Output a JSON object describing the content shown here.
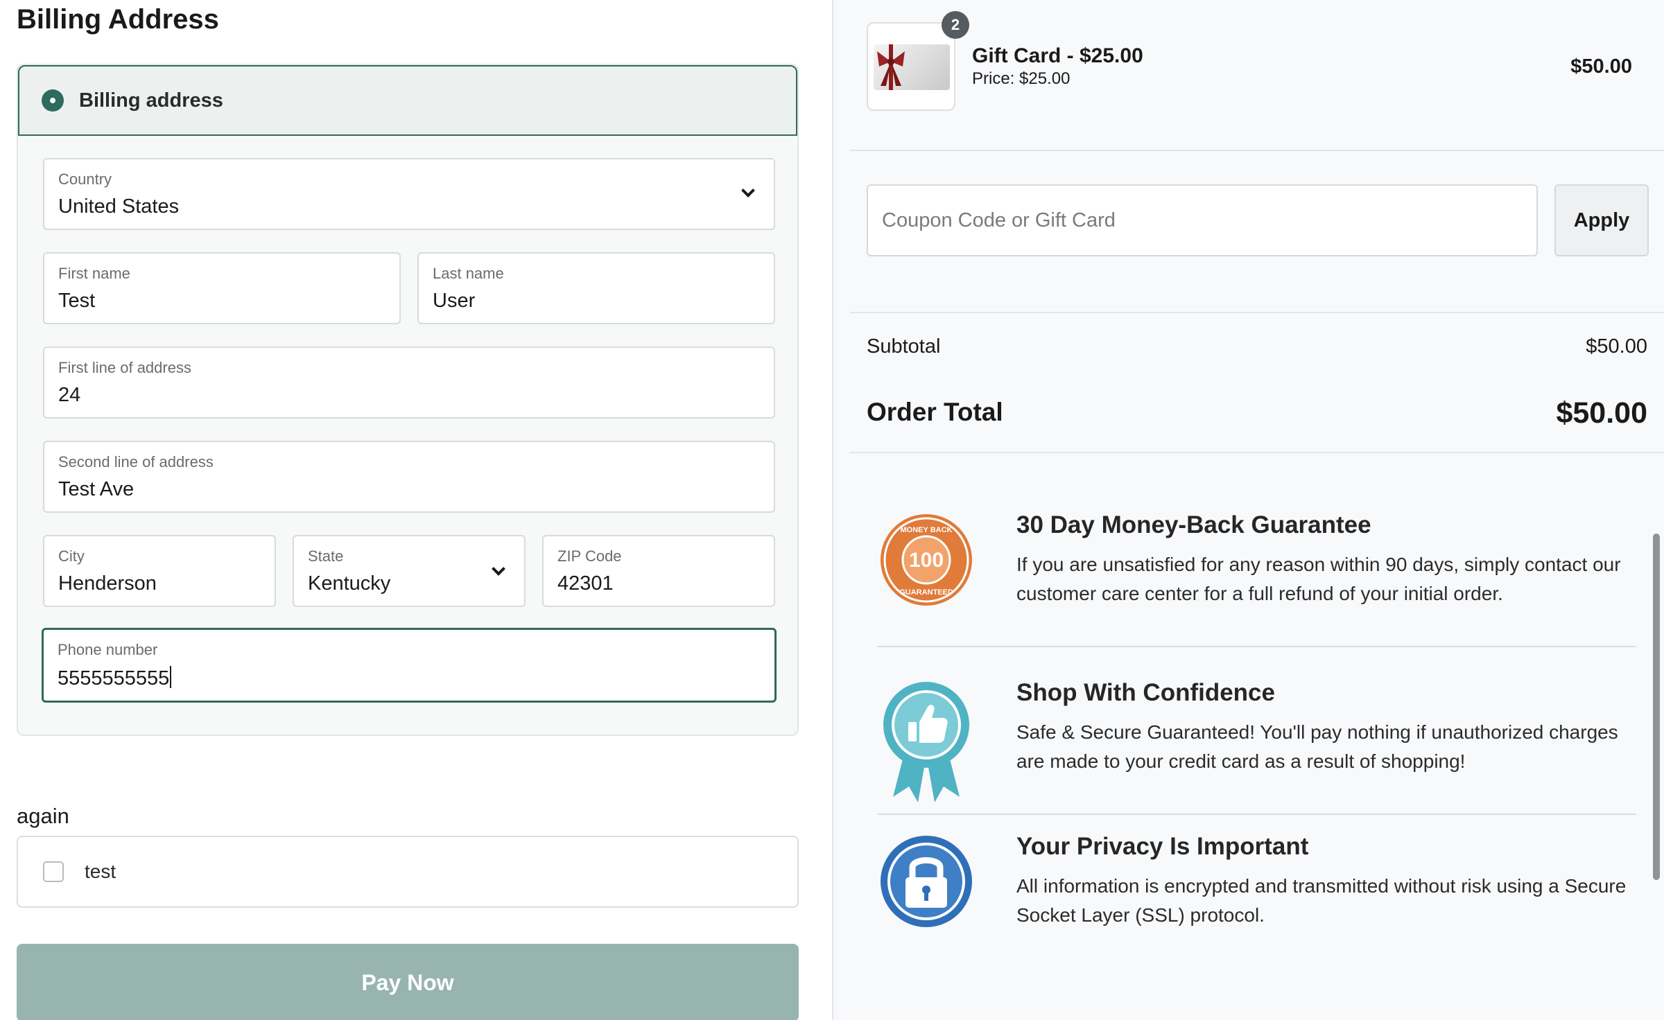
{
  "billing": {
    "section_title": "Billing Address",
    "option_label": "Billing address",
    "country": {
      "label": "Country",
      "value": "United States"
    },
    "first_name": {
      "label": "First name",
      "value": "Test"
    },
    "last_name": {
      "label": "Last name",
      "value": "User"
    },
    "address1": {
      "label": "First line of address",
      "value": "24"
    },
    "address2": {
      "label": "Second line of address",
      "value": "Test Ave"
    },
    "city": {
      "label": "City",
      "value": "Henderson"
    },
    "state": {
      "label": "State",
      "value": "Kentucky"
    },
    "zip": {
      "label": "ZIP Code",
      "value": "42301"
    },
    "phone": {
      "label": "Phone number",
      "value": "5555555555"
    }
  },
  "again": {
    "label": "again",
    "checkbox_label": "test",
    "checked": false
  },
  "pay_button": {
    "label": "Pay Now",
    "color": "#97b5ae"
  },
  "order": {
    "product": {
      "name": "Gift Card - $25.00",
      "price": "Price: $25.00",
      "quantity": "2",
      "line_total": "$50.00"
    },
    "coupon": {
      "placeholder": "Coupon Code or Gift Card",
      "apply_label": "Apply"
    },
    "subtotal_label": "Subtotal",
    "subtotal_value": "$50.00",
    "total_label": "Order Total",
    "total_value": "$50.00"
  },
  "trust": [
    {
      "icon": "money-back-badge-icon",
      "title": "30 Day Money-Back Guarantee",
      "description": "If you are unsatisfied for any reason within 90 days, simply contact our customer care center for a full refund of your initial order.",
      "badge_text": "100",
      "badge_ring_top": "MONEY BACK",
      "badge_ring_bottom": "GUARANTEED"
    },
    {
      "icon": "thumbs-up-ribbon-icon",
      "title": "Shop With Confidence",
      "description": "Safe & Secure Guaranteed! You'll pay nothing if unauthorized charges are made to your credit card as a result of shopping!"
    },
    {
      "icon": "lock-badge-icon",
      "title": "Your Privacy Is Important",
      "description": "All information is encrypted and transmitted without risk using a Secure Socket Layer (SSL) protocol."
    }
  ],
  "colors": {
    "accent": "#2f6a5f",
    "orange_badge": "#e07b39",
    "teal_badge": "#4fb3c3",
    "blue_badge": "#2f6fb8"
  }
}
